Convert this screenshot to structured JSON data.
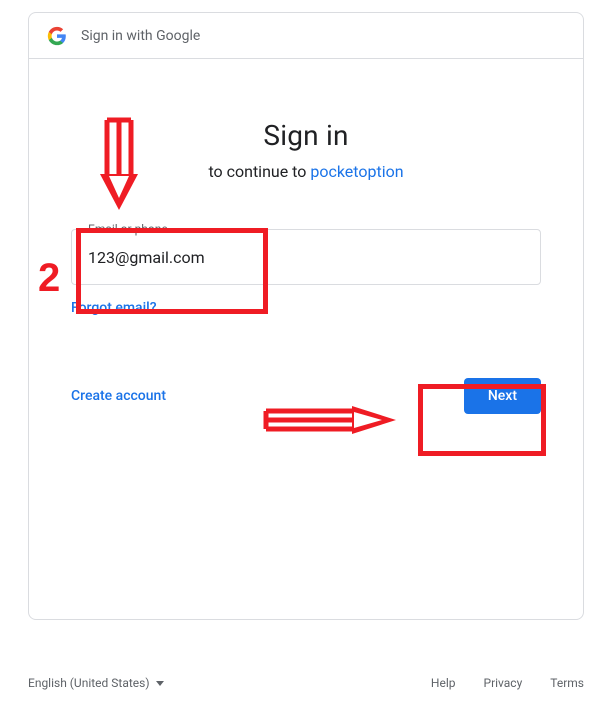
{
  "header": {
    "title": "Sign in with Google"
  },
  "main": {
    "heading": "Sign in",
    "subtitle_prefix": "to continue to ",
    "app_name": "pocketoption",
    "email_label": "Email or phone",
    "email_value": "123@gmail.com",
    "forgot_email": "Forgot email?",
    "create_account": "Create account",
    "next_button": "Next"
  },
  "footer": {
    "language": "English (United States)",
    "links": {
      "help": "Help",
      "privacy": "Privacy",
      "terms": "Terms"
    }
  },
  "annotations": {
    "step_number": "2"
  }
}
